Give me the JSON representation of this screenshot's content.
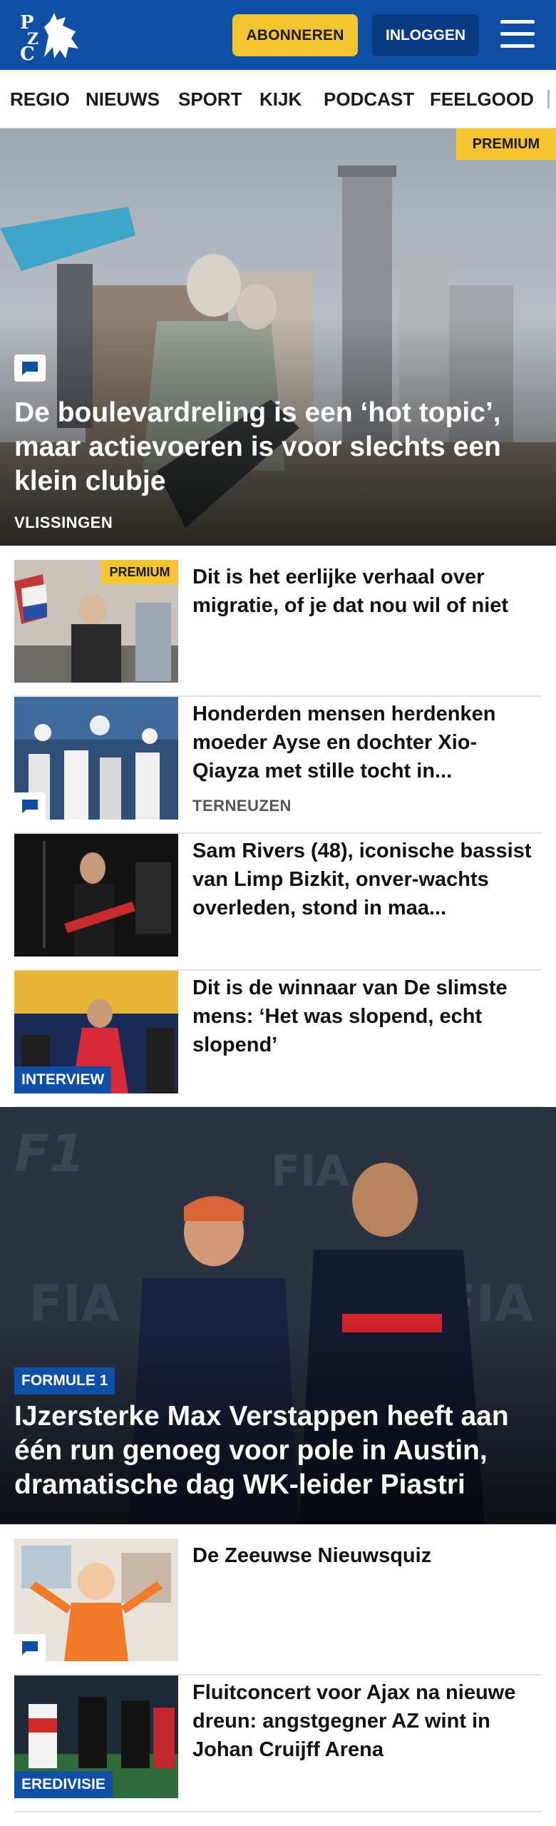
{
  "header": {
    "logo_letters": "PZC",
    "subscribe_label": "ABONNEREN",
    "login_label": "INLOGGEN",
    "menu_icon": "hamburger-icon"
  },
  "nav": {
    "items": [
      "REGIO",
      "NIEUWS",
      "SPORT",
      "KIJK",
      "PODCAST",
      "FEELGOOD"
    ]
  },
  "hero": {
    "badge": "PREMIUM",
    "title": "De boulevardreling is een ‘hot topic’, maar actievoeren is voor slechts een klein clubje",
    "label": "VLISSINGEN",
    "icon": "comment-icon"
  },
  "articles": [
    {
      "title": "Dit is het eerlijke verhaal over migratie, of je dat nou wil of niet",
      "badge": "PREMIUM",
      "label": "",
      "tag": ""
    },
    {
      "title": "Honderden mensen herdenken moeder Ayse en dochter Xio-Qiayza met stille tocht in...",
      "badge": "",
      "label": "TERNEUZEN",
      "tag": "",
      "icon": "comment-icon"
    },
    {
      "title": "Sam Rivers (48), iconische bassist van Limp Bizkit, onver-wachts overleden, stond in maa...",
      "badge": "",
      "label": "",
      "tag": ""
    },
    {
      "title": "Dit is de winnaar van De slimste mens: ‘Het was slopend, echt slopend’",
      "badge": "",
      "label": "",
      "tag": "INTERVIEW"
    }
  ],
  "feature": {
    "tag": "FORMULE 1",
    "title": "IJzersterke Max Verstappen heeft aan één run genoeg voor pole in Austin, dramatische dag WK-leider Piastri"
  },
  "articles2": [
    {
      "title": "De Zeeuwse Nieuwsquiz",
      "tag": "",
      "icon": "comment-icon"
    },
    {
      "title": "Fluitconcert voor Ajax na nieuwe dreun: angstgegner AZ wint in Johan Cruijff Arena",
      "tag": "EREDIVISIE"
    }
  ],
  "colors": {
    "brand_blue": "#0e4ea5",
    "accent_yellow": "#f4c431"
  }
}
